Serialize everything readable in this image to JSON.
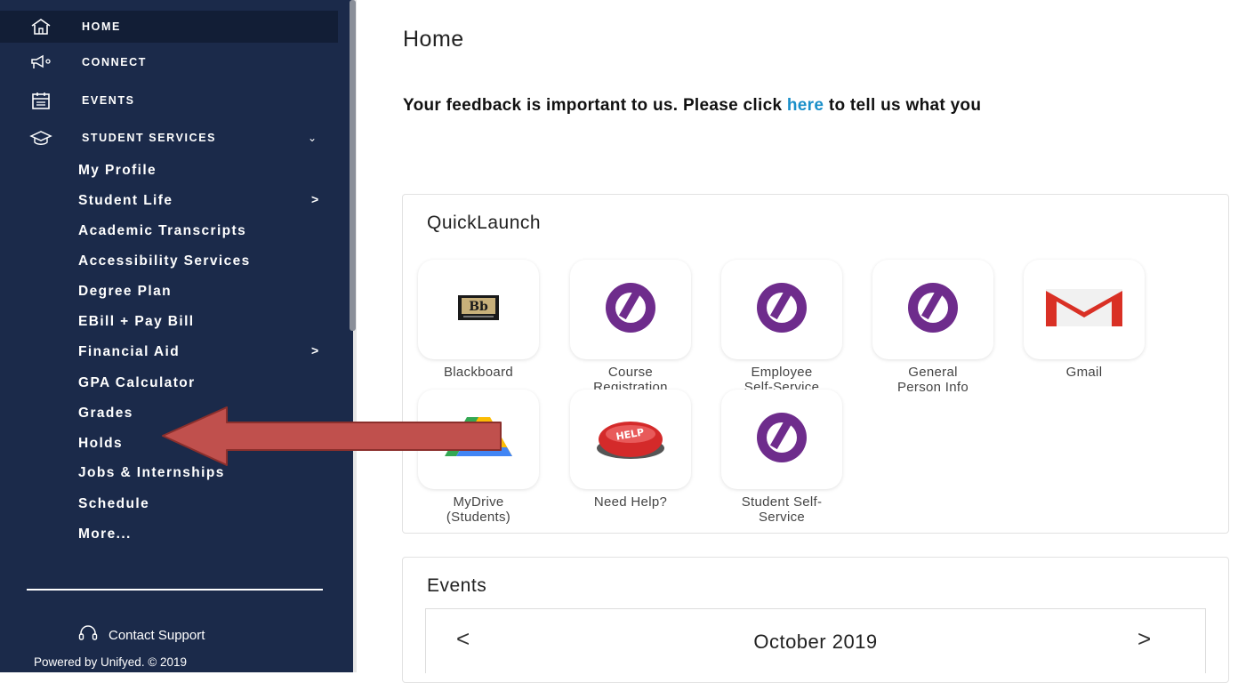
{
  "sidebar": {
    "top_items": [
      {
        "label": "HOME",
        "icon": "home-icon"
      },
      {
        "label": "CONNECT",
        "icon": "megaphone-icon"
      },
      {
        "label": "EVENTS",
        "icon": "calendar-icon"
      },
      {
        "label": "STUDENT SERVICES",
        "icon": "graduation-cap-icon",
        "chevron": "⌄"
      }
    ],
    "sub_items": [
      {
        "label": "My Profile"
      },
      {
        "label": "Student Life",
        "arrow": ">"
      },
      {
        "label": "Academic Transcripts"
      },
      {
        "label": "Accessibility Services"
      },
      {
        "label": "Degree Plan"
      },
      {
        "label": "EBill + Pay Bill"
      },
      {
        "label": "Financial Aid",
        "arrow": ">"
      },
      {
        "label": "GPA Calculator"
      },
      {
        "label": "Grades"
      },
      {
        "label": "Holds"
      },
      {
        "label": "Jobs & Internships"
      },
      {
        "label": "Schedule"
      },
      {
        "label": "More..."
      }
    ],
    "support_label": "Contact Support",
    "powered_by": "Powered by Unifyed. © 2019",
    "colors": {
      "background": "#1b2a4a",
      "active": "#121e36"
    }
  },
  "main": {
    "title": "Home",
    "feedback_before": "Your feedback is important to us. Please click ",
    "feedback_link": "here",
    "feedback_after": " to tell us what you"
  },
  "quicklaunch": {
    "title": "QuickLaunch",
    "tiles": [
      {
        "label1": "Blackboard",
        "label2": "",
        "icon": "blackboard-icon"
      },
      {
        "label1": "Course",
        "label2": "Registration",
        "icon": "ellucian-icon"
      },
      {
        "label1": "Employee",
        "label2": "Self-Service",
        "icon": "ellucian-icon"
      },
      {
        "label1": "General",
        "label2": "Person Info",
        "icon": "ellucian-icon"
      },
      {
        "label1": "Gmail",
        "label2": "",
        "icon": "gmail-icon"
      },
      {
        "label1": "MyDrive",
        "label2": "(Students)",
        "icon": "google-drive-icon"
      },
      {
        "label1": "Need Help?",
        "label2": "",
        "icon": "help-button-icon"
      },
      {
        "label1": "Student Self-",
        "label2": "Service",
        "icon": "ellucian-icon"
      }
    ]
  },
  "events": {
    "title": "Events",
    "month": "October 2019",
    "prev": "<",
    "next": ">"
  },
  "annotation": {
    "icon": "red-arrow-icon",
    "color": "#c0504d"
  }
}
